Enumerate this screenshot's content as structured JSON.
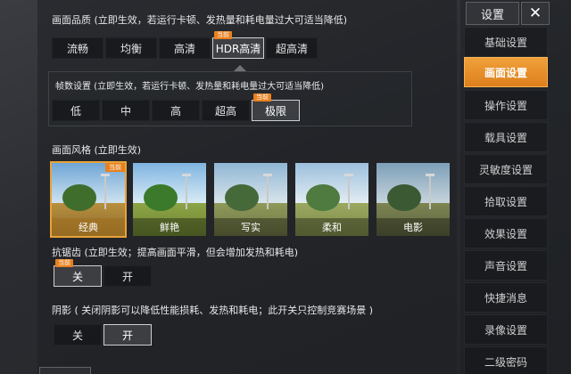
{
  "quality": {
    "title": "画面品质 (立即生效，若运行卡顿、发热量和耗电量过大可适当降低)",
    "tag": "当前",
    "options": [
      "流畅",
      "均衡",
      "高清",
      "HDR高清",
      "超高清"
    ],
    "selected": "HDR高清"
  },
  "framerate": {
    "title": "帧数设置 (立即生效，若运行卡顿、发热量和耗电量过大可适当降低)",
    "tag": "当前",
    "options": [
      "低",
      "中",
      "高",
      "超高",
      "极限"
    ],
    "selected": "极限"
  },
  "style": {
    "title": "画面风格 (立即生效)",
    "tag": "当前",
    "options": [
      "经典",
      "鲜艳",
      "写实",
      "柔和",
      "电影"
    ],
    "selected": "经典"
  },
  "antialias": {
    "title": "抗锯齿 (立即生效；提高画面平滑，但会增加发热和耗电)",
    "tag": "当前",
    "off": "关",
    "on": "开",
    "selected": "关"
  },
  "shadow": {
    "title": "阴影 ( 关闭阴影可以降低性能损耗、发热和耗电；此开关只控制竞赛场景 )",
    "off": "关",
    "on": "开",
    "selected": "开"
  },
  "sidebar": {
    "title": "设置",
    "close_icon": "close-icon",
    "items": [
      "基础设置",
      "画面设置",
      "操作设置",
      "载具设置",
      "灵敏度设置",
      "拾取设置",
      "效果设置",
      "声音设置",
      "快捷消息",
      "录像设置",
      "二级密码"
    ],
    "active": "画面设置"
  },
  "colors": {
    "accent": "#e8811e",
    "active_tab": "#f0a13a"
  }
}
